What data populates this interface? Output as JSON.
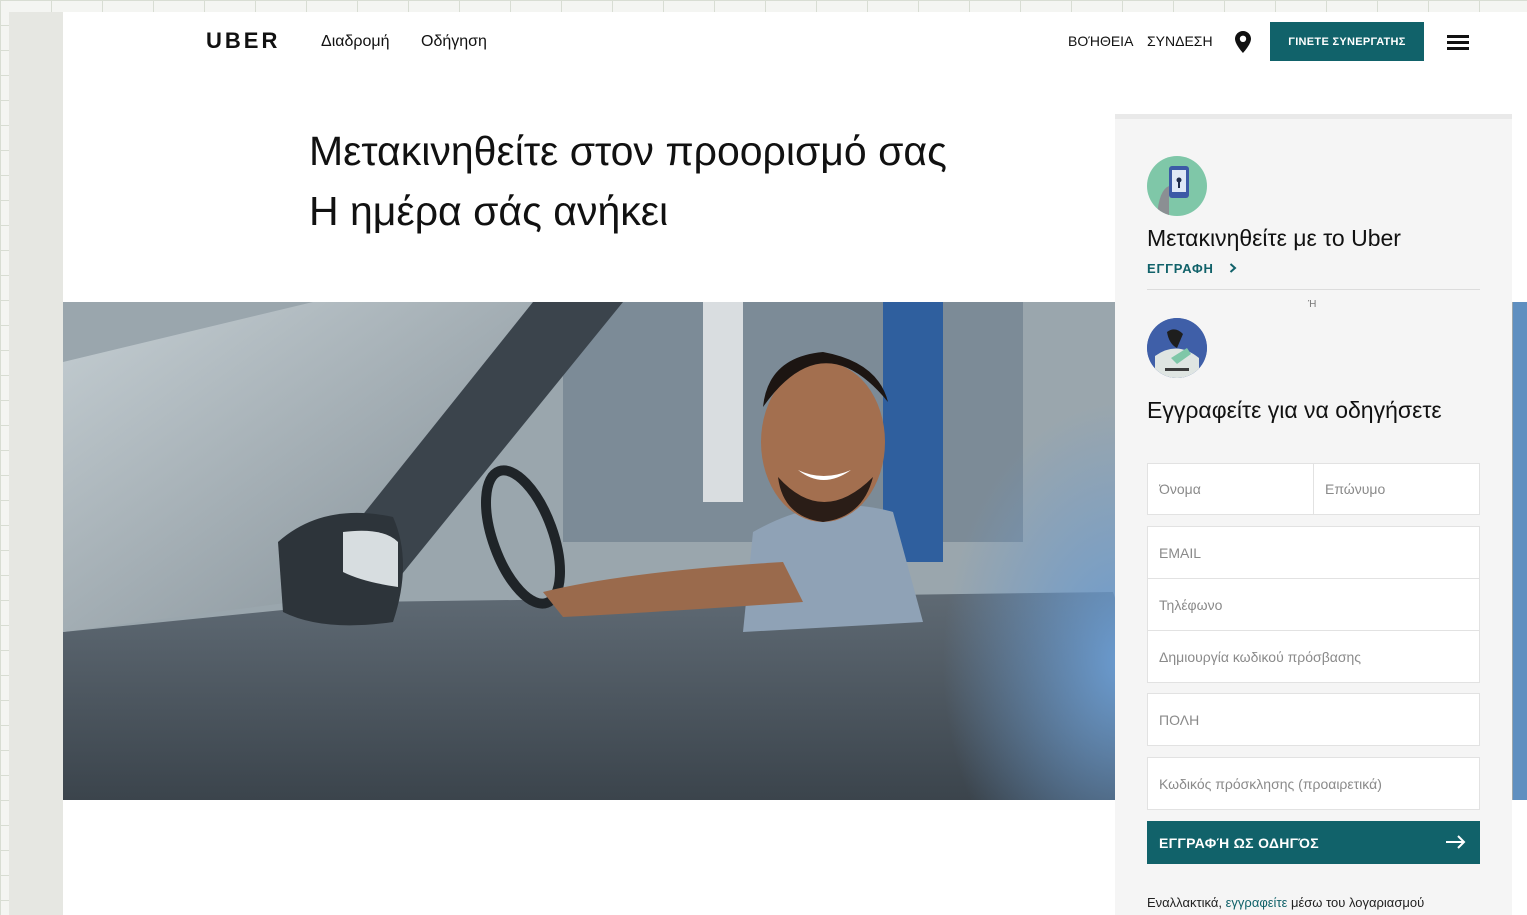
{
  "header": {
    "logo": "UBER",
    "nav_ride": "Διαδρομή",
    "nav_drive": "Οδήγηση",
    "help": "ΒΟΉΘΕΙΑ",
    "signin": "ΣΥΝΔΕΣΗ",
    "partner_button": "ΓΙΝΕΤΕ ΣΥΝΕΡΓΑΤΗΣ",
    "location_icon": "map-pin-icon",
    "menu_icon": "hamburger-menu-icon"
  },
  "hero": {
    "line1": "Μετακινηθείτε στον προορισμό σας",
    "line2": "Η ημέρα σάς ανήκει"
  },
  "card": {
    "ride_title": "Μετακινηθείτε με το Uber",
    "ride_signup": "ΕΓΓΡΑΦΗ",
    "or_text": "Ή",
    "drive_title": "Εγγραφείτε για να οδηγήσετε",
    "fields": {
      "first_name": "Όνομα",
      "last_name": "Επώνυμο",
      "email": "EMAIL",
      "phone": "Τηλέφωνο",
      "password": "Δημιουργία κωδικού πρόσβασης",
      "city": "ΠΟΛΗ",
      "invite": "Κωδικός πρόσκλησης (προαιρετικά)"
    },
    "submit": "ΕΓΓΡΑΦΉ ΩΣ ΟΔΗΓΌΣ",
    "footer_prefix": "Εναλλακτικά,",
    "footer_link": "εγγραφείτε",
    "footer_suffix": "μέσω του λογαριασμού"
  },
  "colors": {
    "accent": "#11626a",
    "card_bg": "#f5f5f5"
  }
}
